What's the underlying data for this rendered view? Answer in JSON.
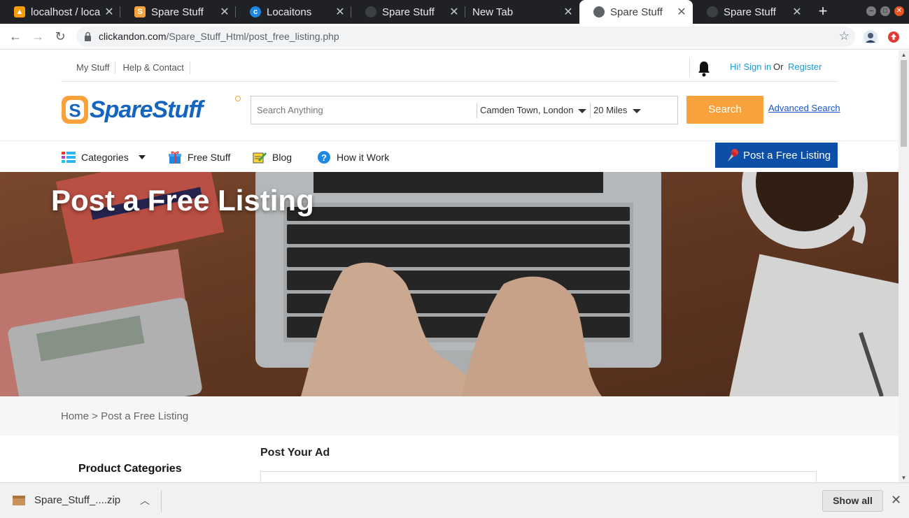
{
  "browser": {
    "tabs": [
      {
        "title": "localhost / loca",
        "favicon": "phpmyadmin-icon",
        "active": false
      },
      {
        "title": "Spare Stuff",
        "favicon": "sparestuff-icon",
        "active": false
      },
      {
        "title": "Locaitons",
        "favicon": "c-icon",
        "active": false
      },
      {
        "title": "Spare Stuff",
        "favicon": "globe-icon",
        "active": false
      },
      {
        "title": "New Tab",
        "favicon": "",
        "active": false
      },
      {
        "title": "Spare Stuff",
        "favicon": "globe-icon",
        "active": true
      },
      {
        "title": "Spare Stuff",
        "favicon": "globe-icon",
        "active": false
      }
    ],
    "url_host": "clickandon.com",
    "url_path": "/Spare_Stuff_Html/post_free_listing.php"
  },
  "header": {
    "top_links": [
      "My Stuff",
      "Help & Contact"
    ],
    "signin": "Hi! Sign in",
    "or": "Or",
    "register": "Register"
  },
  "logo": {
    "text": "SpareStuff"
  },
  "search": {
    "placeholder": "Search Anything",
    "location": "Camden Town, London",
    "radius": "20 Miles",
    "button": "Search",
    "advanced": "Advanced Search"
  },
  "nav": {
    "categories": "Categories",
    "free_stuff": "Free Stuff",
    "blog": "Blog",
    "how_it_work": "How it Work",
    "post_button": "Post a Free Listing"
  },
  "hero": {
    "title": "Post a Free Listing"
  },
  "breadcrumb": "Home > Post a Free Listing",
  "sidebar": {
    "heading": "Product Categories"
  },
  "main": {
    "heading": "Post Your Ad"
  },
  "downloads": {
    "file": "Spare_Stuff_....zip",
    "show_all": "Show all"
  },
  "colors": {
    "accent_orange": "#f9a23b",
    "brand_blue": "#0b4fa8",
    "link_blue": "#1a9bd7"
  }
}
